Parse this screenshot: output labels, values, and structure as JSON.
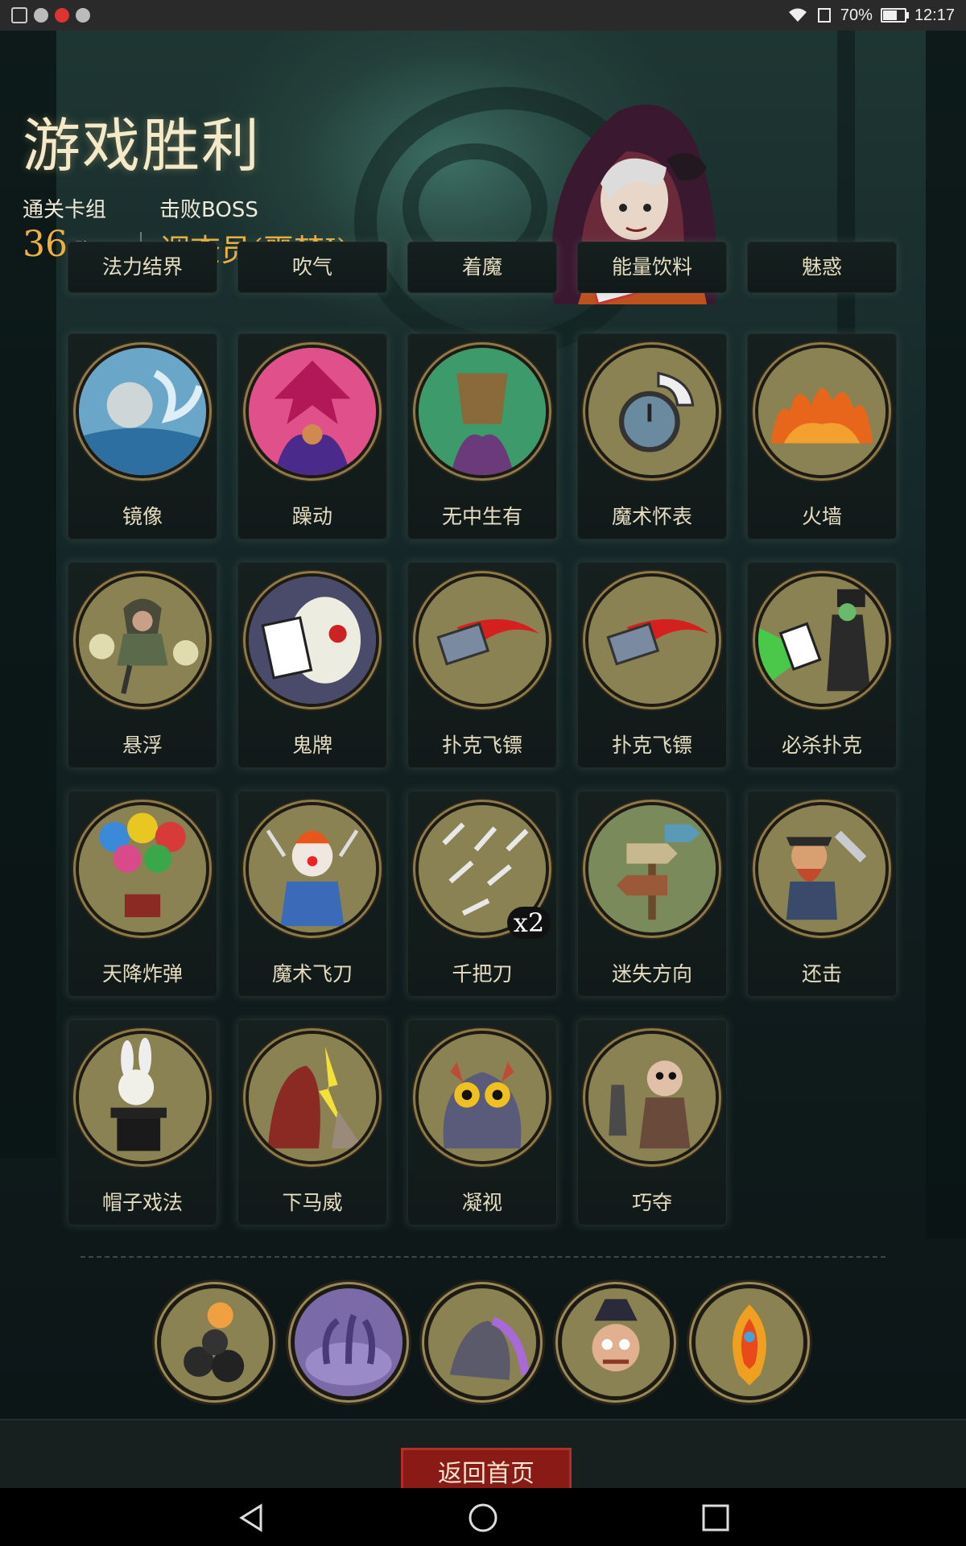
{
  "status_bar": {
    "battery": "70%",
    "time": "12:17",
    "icons": [
      "gallery-icon",
      "notification-icon",
      "weibo-icon",
      "notification-icon"
    ]
  },
  "header": {
    "title": "游戏胜利",
    "deck_label": "通关卡组",
    "deck_count": "36",
    "deck_unit": "张",
    "boss_label": "击败BOSS",
    "boss_name": "调查员(噩梦I)"
  },
  "partial_row": [
    "法力结界",
    "吹气",
    "着魔",
    "能量饮料",
    "魅惑"
  ],
  "cards": [
    {
      "name": "镜像",
      "icon": "mirror-moon-icon"
    },
    {
      "name": "躁动",
      "icon": "frenzy-icon"
    },
    {
      "name": "无中生有",
      "icon": "something-from-nothing-icon"
    },
    {
      "name": "魔术怀表",
      "icon": "pocket-watch-icon"
    },
    {
      "name": "火墙",
      "icon": "fire-wall-icon"
    },
    {
      "name": "悬浮",
      "icon": "levitate-icon"
    },
    {
      "name": "鬼牌",
      "icon": "joker-skull-icon"
    },
    {
      "name": "扑克飞镖",
      "icon": "card-dart-icon"
    },
    {
      "name": "扑克飞镖",
      "icon": "card-dart-icon"
    },
    {
      "name": "必杀扑克",
      "icon": "killer-poker-icon"
    },
    {
      "name": "天降炸弹",
      "icon": "balloon-bomb-icon"
    },
    {
      "name": "魔术飞刀",
      "icon": "clown-knife-icon"
    },
    {
      "name": "千把刀",
      "icon": "thousand-knives-icon",
      "badge": "x2"
    },
    {
      "name": "迷失方向",
      "icon": "signpost-icon"
    },
    {
      "name": "还击",
      "icon": "counter-attack-icon"
    },
    {
      "name": "帽子戏法",
      "icon": "rabbit-hat-icon"
    },
    {
      "name": "下马威",
      "icon": "beast-strike-icon"
    },
    {
      "name": "凝视",
      "icon": "owl-gaze-icon"
    },
    {
      "name": "巧夺",
      "icon": "pickpocket-icon"
    }
  ],
  "relics": [
    {
      "icon": "bomb-cluster-icon"
    },
    {
      "icon": "tentacle-portal-icon"
    },
    {
      "icon": "dark-knight-icon"
    },
    {
      "icon": "crazed-man-icon"
    },
    {
      "icon": "phoenix-feather-icon"
    }
  ],
  "home_button": "返回首页",
  "colors": {
    "accent_gold": "#f0b040",
    "button_red": "#8a1a16",
    "card_bg": "#111a19",
    "art_bg": "#7f7850"
  }
}
